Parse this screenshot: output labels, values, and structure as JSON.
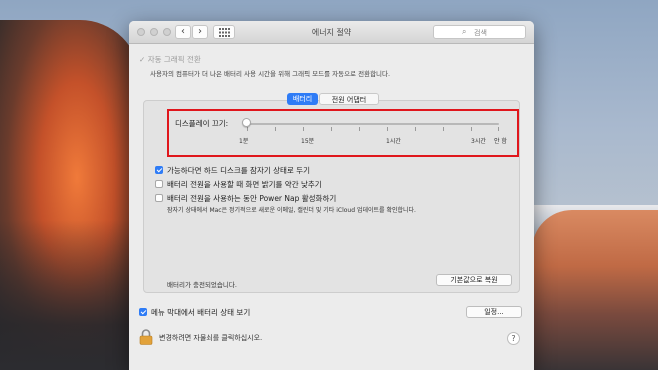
{
  "window": {
    "title": "에너지 절약",
    "back": "‹",
    "forward": "›",
    "search_placeholder": "검색"
  },
  "auto_graphics": {
    "label": "자동 그래픽 전환",
    "description": "사용자의 컴퓨터가 더 나은 배터리 사용 시간을 위해 그래픽 모드를 자동으로 전환합니다.",
    "checked": true,
    "enabled": false
  },
  "tabs": [
    {
      "label": "배터리",
      "active": true
    },
    {
      "label": "전원 어댑터",
      "active": false
    }
  ],
  "display_sleep": {
    "label": "디스플레이 끄기:",
    "value": "1분",
    "ticks": [
      "1분",
      "15분",
      "1시간",
      "3시간",
      "안 함"
    ]
  },
  "options": [
    {
      "label": "가능하다면 하드 디스크를 잠자기 상태로 두기",
      "checked": true
    },
    {
      "label": "배터리 전원을 사용할 때 화면 밝기를 약간 낮추기",
      "checked": false
    },
    {
      "label": "배터리 전원을 사용하는 동안 Power Nap 활성화하기",
      "checked": false
    }
  ],
  "power_nap_description": "잠자기 상태에서 Mac은 정기적으로 새로운 이메일, 캘린더 및 기타 iCloud 업데이트를 확인합니다.",
  "battery_status": "배터리가 충전되었습니다.",
  "restore_defaults_button": "기본값으로 복원",
  "menubar_option": {
    "label": "메뉴 막대에서 배터리 상태 보기",
    "checked": true
  },
  "schedule_button": "일정...",
  "lock_text": "변경하려면 자물쇠를 클릭하십시오.",
  "help_label": "?",
  "colors": {
    "accent": "#2f7cf6",
    "highlight": "#e0161c"
  }
}
